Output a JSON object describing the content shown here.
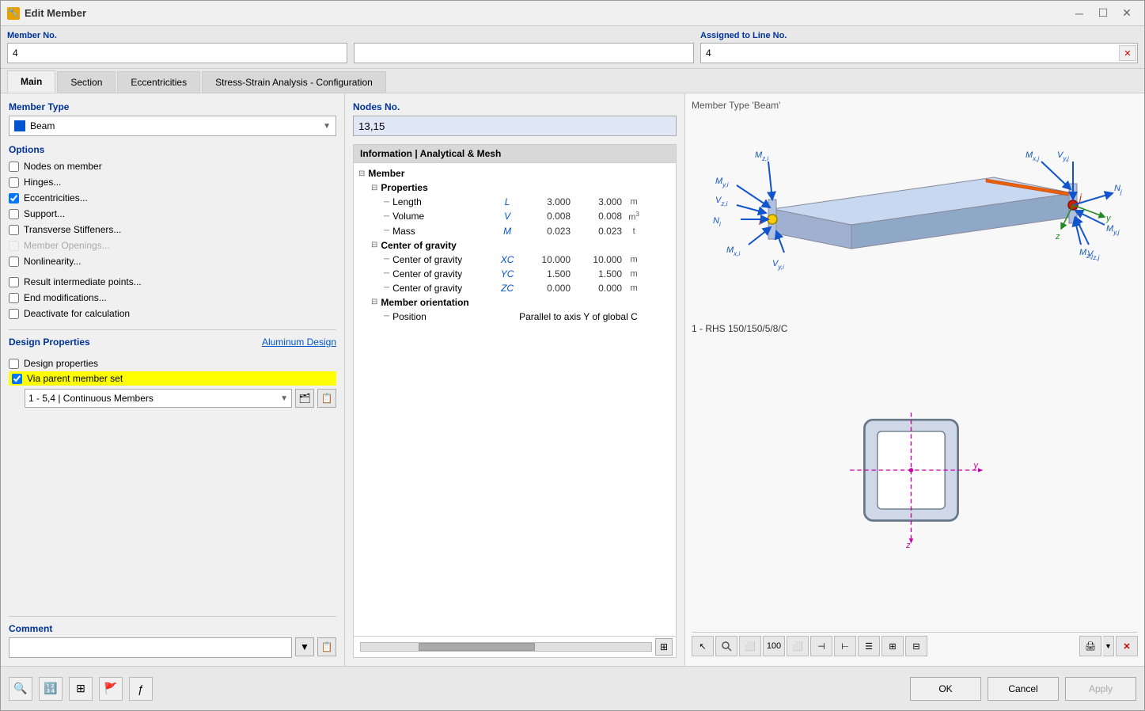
{
  "window": {
    "title": "Edit Member",
    "icon": "🔧"
  },
  "header": {
    "member_no_label": "Member No.",
    "member_no_value": "4",
    "middle_value": "",
    "assigned_label": "Assigned to Line No.",
    "assigned_value": "4"
  },
  "tabs": [
    {
      "id": "main",
      "label": "Main",
      "active": true
    },
    {
      "id": "section",
      "label": "Section",
      "active": false
    },
    {
      "id": "eccentricities",
      "label": "Eccentricities",
      "active": false
    },
    {
      "id": "stress-strain",
      "label": "Stress-Strain Analysis - Configuration",
      "active": false
    }
  ],
  "left": {
    "member_type_label": "Member Type",
    "member_type_value": "Beam",
    "options_label": "Options",
    "checkboxes": [
      {
        "id": "nodes_on_member",
        "label": "Nodes on member",
        "checked": false,
        "disabled": false
      },
      {
        "id": "hinges",
        "label": "Hinges...",
        "checked": false,
        "disabled": false
      },
      {
        "id": "eccentricities",
        "label": "Eccentricities...",
        "checked": true,
        "disabled": false
      },
      {
        "id": "support",
        "label": "Support...",
        "checked": false,
        "disabled": false
      },
      {
        "id": "transverse_stiffeners",
        "label": "Transverse Stiffeners...",
        "checked": false,
        "disabled": false
      },
      {
        "id": "member_openings",
        "label": "Member Openings...",
        "checked": false,
        "disabled": true
      },
      {
        "id": "nonlinearity",
        "label": "Nonlinearity...",
        "checked": false,
        "disabled": false
      },
      {
        "id": "result_intermediate",
        "label": "Result intermediate points...",
        "checked": false,
        "disabled": false
      },
      {
        "id": "end_modifications",
        "label": "End modifications...",
        "checked": false,
        "disabled": false
      },
      {
        "id": "deactivate",
        "label": "Deactivate for calculation",
        "checked": false,
        "disabled": false
      }
    ],
    "design_props_label": "Design Properties",
    "aluminum_design_label": "Aluminum Design",
    "design_checkboxes": [
      {
        "id": "design_properties",
        "label": "Design properties",
        "checked": false
      },
      {
        "id": "via_parent",
        "label": "Via parent member set",
        "checked": true,
        "highlighted": true
      }
    ],
    "member_set_value": "1 - 5,4 | Continuous Members",
    "comment_label": "Comment"
  },
  "middle": {
    "nodes_label": "Nodes No.",
    "nodes_value": "13,15",
    "info_label": "Information | Analytical & Mesh",
    "tree": {
      "member": {
        "label": "Member",
        "properties": {
          "label": "Properties",
          "rows": [
            {
              "name": "Length",
              "sym": "L",
              "val1": "3.000",
              "val2": "3.000",
              "unit": "m"
            },
            {
              "name": "Volume",
              "sym": "V",
              "val1": "0.008",
              "val2": "0.008",
              "unit": "m³"
            },
            {
              "name": "Mass",
              "sym": "M",
              "val1": "0.023",
              "val2": "0.023",
              "unit": "t"
            }
          ]
        },
        "center_of_gravity": {
          "label": "Center of gravity",
          "rows": [
            {
              "name": "Center of gravity",
              "sym": "XC",
              "val1": "10.000",
              "val2": "10.000",
              "unit": "m"
            },
            {
              "name": "Center of gravity",
              "sym": "YC",
              "val1": "1.500",
              "val2": "1.500",
              "unit": "m"
            },
            {
              "name": "Center of gravity",
              "sym": "ZC",
              "val1": "0.000",
              "val2": "0.000",
              "unit": "m"
            }
          ]
        },
        "member_orientation": {
          "label": "Member orientation",
          "rows": [
            {
              "name": "Position",
              "sym": "",
              "val1": "",
              "val2": "Parallel to axis Y of global C"
            }
          ]
        }
      }
    }
  },
  "right": {
    "member_type_label": "Member Type 'Beam'",
    "section_name": "1 - RHS 150/150/5/8/C",
    "toolbar_buttons": [
      "cursor",
      "zoom",
      "frame",
      "number",
      "section",
      "split-left",
      "split-right",
      "split-h",
      "table",
      "grid",
      "print",
      "print-down",
      "close-x"
    ]
  },
  "bottom": {
    "icons": [
      "search",
      "number",
      "grid",
      "flag",
      "function"
    ],
    "ok_label": "OK",
    "cancel_label": "Cancel",
    "apply_label": "Apply"
  }
}
